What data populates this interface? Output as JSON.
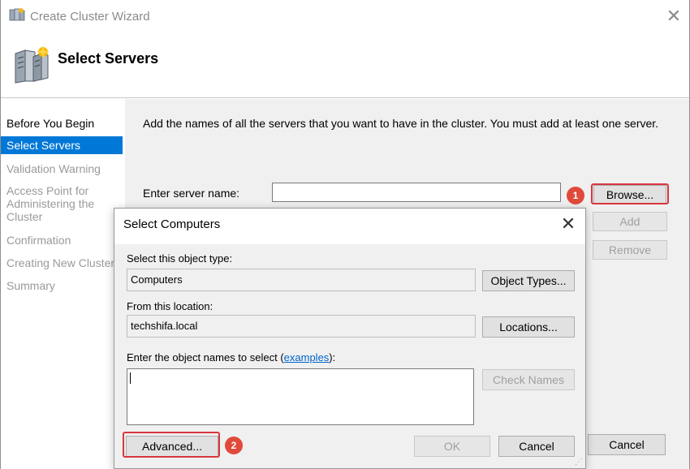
{
  "window": {
    "title": "Create Cluster Wizard",
    "close_glyph": "✕",
    "icon": "cluster-wizard-icon"
  },
  "header": {
    "title": "Select Servers",
    "icon": "servers-icon"
  },
  "sidebar": {
    "steps": [
      {
        "label": "Before You Begin"
      },
      {
        "label": "Select Servers"
      },
      {
        "label": "Validation Warning"
      },
      {
        "label": "Access Point for Administering the Cluster"
      },
      {
        "label": "Confirmation"
      },
      {
        "label": "Creating New Cluster"
      },
      {
        "label": "Summary"
      }
    ]
  },
  "main": {
    "description": "Add the names of all the servers that you want to have in the cluster. You must add at least one server.",
    "server_name_label": "Enter server name:",
    "server_name_value": "",
    "browse_label": "Browse...",
    "add_label": "Add",
    "remove_label": "Remove",
    "cancel_label": "Cancel"
  },
  "dialog": {
    "title": "Select Computers",
    "close_glyph": "✕",
    "object_type_label": "Select this object type:",
    "object_type_value": "Computers",
    "object_types_button": "Object Types...",
    "location_label": "From this location:",
    "location_value": "techshifa.local",
    "locations_button": "Locations...",
    "names_label_prefix": "Enter the object names to select (",
    "names_label_link": "examples",
    "names_label_suffix": "):",
    "check_names_button": "Check Names",
    "advanced_button": "Advanced...",
    "ok_button": "OK",
    "cancel_button": "Cancel"
  },
  "annotations": {
    "badge_1": "1",
    "badge_2": "2",
    "highlight_color": "#d9363e"
  },
  "colors": {
    "accent": "#0078d7",
    "link": "#0066cc"
  }
}
